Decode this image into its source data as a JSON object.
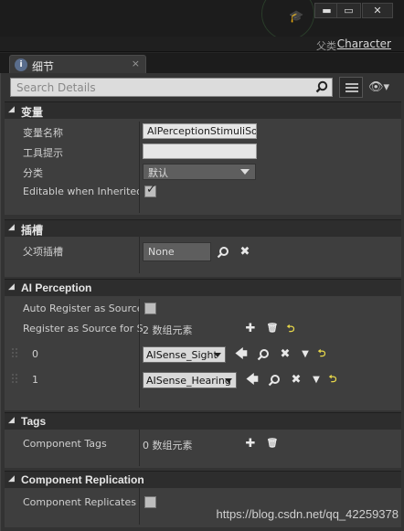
{
  "window": {
    "minimize_glyph": "▬",
    "maximize_glyph": "▭",
    "close_glyph": "✕",
    "parent_label": "父类",
    "parent_class": "Character"
  },
  "tab": {
    "label": "细节",
    "icon_glyph": "i",
    "close_glyph": "×"
  },
  "search": {
    "placeholder": "Search Details"
  },
  "sections": {
    "variable": {
      "title": "变量",
      "rows": {
        "var_name_label": "变量名称",
        "var_name_value": "AIPerceptionStimuliSou",
        "tooltip_label": "工具提示",
        "tooltip_value": "",
        "category_label": "分类",
        "category_value": "默认",
        "editable_label": "Editable when Inherited"
      }
    },
    "socket": {
      "title": "插槽",
      "parent_socket_label": "父项插槽",
      "parent_socket_value": "None"
    },
    "ai_perception": {
      "title": "AI Perception",
      "auto_register_label": "Auto Register as Source",
      "register_senses_label": "Register as Source for Se",
      "register_senses_count": "2 数组元素",
      "elements": [
        {
          "index": "0",
          "value": "AISense_Sight"
        },
        {
          "index": "1",
          "value": "AISense_Hearing"
        }
      ]
    },
    "tags": {
      "title": "Tags",
      "component_tags_label": "Component Tags",
      "component_tags_count": "0 数组元素"
    },
    "replication": {
      "title": "Component Replication",
      "replicates_label": "Component Replicates"
    }
  },
  "watermark": "https://blog.csdn.net/qq_42259378"
}
